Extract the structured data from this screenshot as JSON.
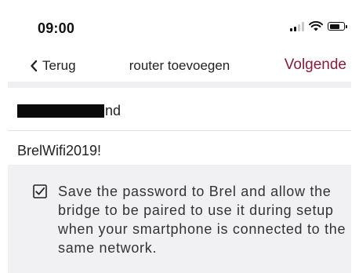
{
  "status_bar": {
    "time": "09:00",
    "icons": [
      "cellular-signal-icon",
      "wifi-icon",
      "battery-icon"
    ],
    "battery_level_percent": 80
  },
  "nav": {
    "back_label": "Terug",
    "title": "router toevoegen",
    "next_label": "Volgende",
    "accent_color": "#8c1b3e"
  },
  "form": {
    "network_name_visible_suffix": "nd",
    "network_name_redacted": true,
    "password": "BrelWifi2019!",
    "save_password_checked": true,
    "save_password_text": "Save the password to Brel and allow the bridge to be paired to use it during setup when your smartphone is connected to the same network."
  }
}
